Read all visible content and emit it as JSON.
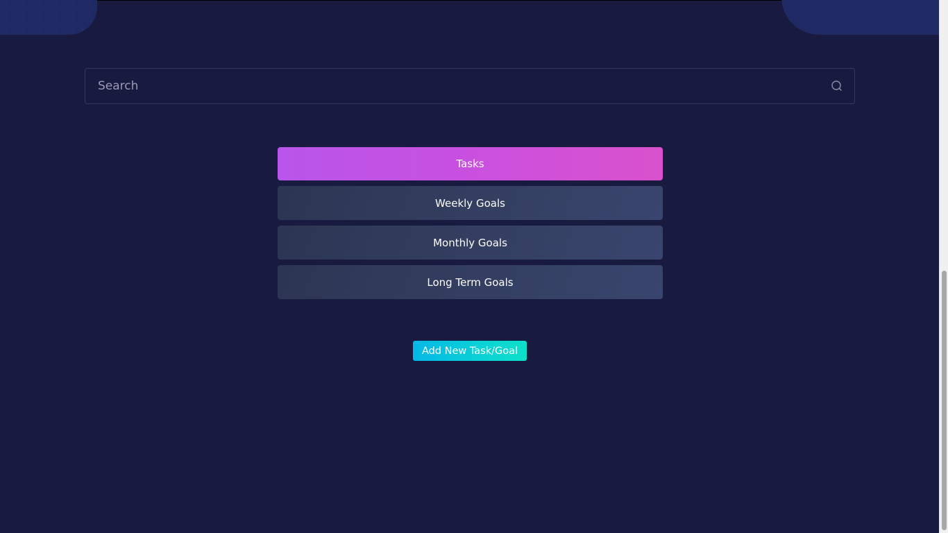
{
  "search": {
    "placeholder": "Search",
    "icon": "search-icon"
  },
  "tabs": [
    {
      "label": "Tasks",
      "active": true
    },
    {
      "label": "Weekly Goals",
      "active": false
    },
    {
      "label": "Monthly Goals",
      "active": false
    },
    {
      "label": "Long Term Goals",
      "active": false
    }
  ],
  "actions": {
    "add_label": "Add New Task/Goal"
  },
  "colors": {
    "background": "#181a3f",
    "accent_active_start": "#b855ea",
    "accent_active_end": "#d951cc",
    "tab_inactive": "#333e60",
    "button_start": "#05b8e6",
    "button_end": "#0de0c8",
    "decoration": "#1f2a64"
  }
}
